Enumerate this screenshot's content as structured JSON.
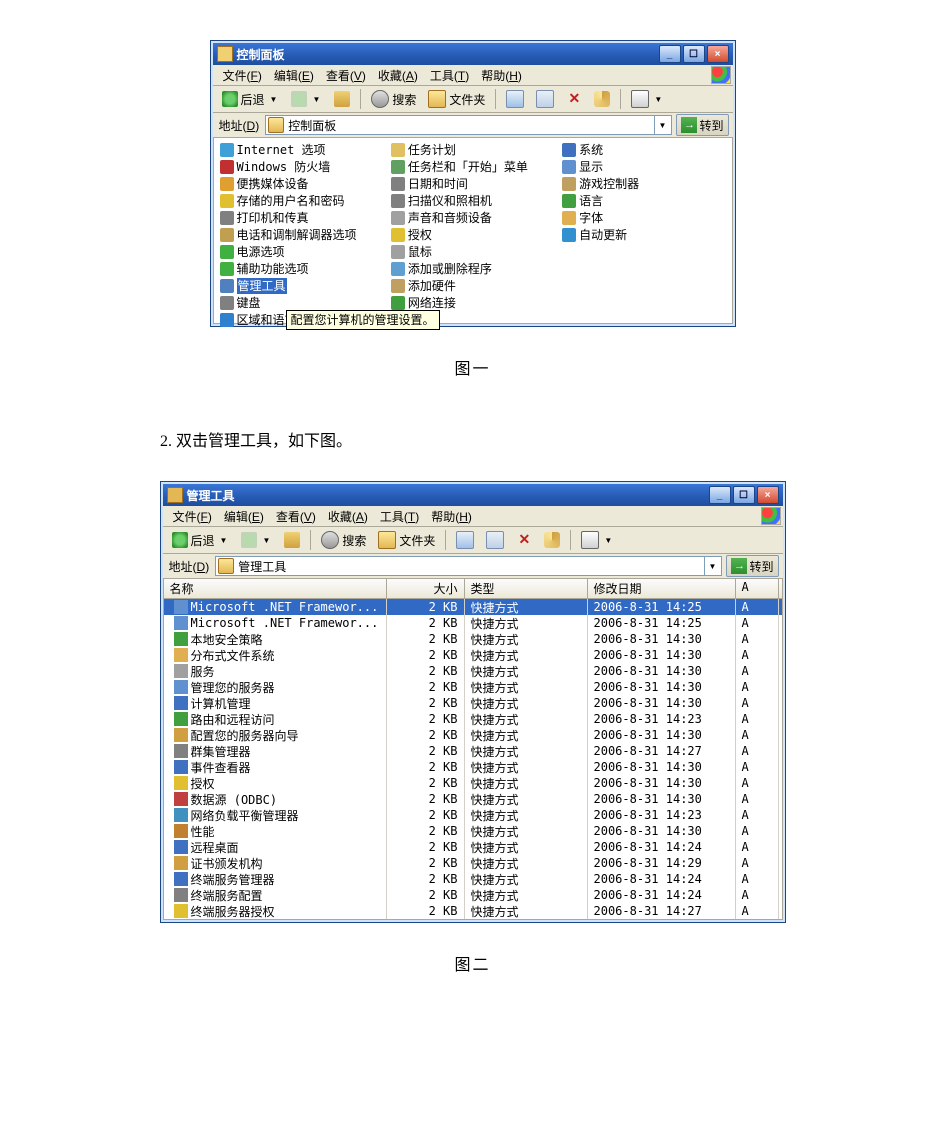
{
  "captions": {
    "fig1": "图一",
    "fig2": "图二"
  },
  "step2_text": "2. 双击管理工具，如下图。",
  "win1": {
    "title": "控制面板",
    "menus": [
      {
        "label": "文件",
        "accel": "F"
      },
      {
        "label": "编辑",
        "accel": "E"
      },
      {
        "label": "查看",
        "accel": "V"
      },
      {
        "label": "收藏",
        "accel": "A"
      },
      {
        "label": "工具",
        "accel": "T"
      },
      {
        "label": "帮助",
        "accel": "H"
      }
    ],
    "toolbar": {
      "back": "后退",
      "search": "搜索",
      "folders": "文件夹"
    },
    "address": {
      "label": "地址",
      "accel": "D",
      "value": "控制面板",
      "go": "转到"
    },
    "selected": "管理工具",
    "tooltip": "配置您计算机的管理设置。",
    "columns": [
      [
        {
          "t": "Internet 选项",
          "c": "#3fa0d8"
        },
        {
          "t": "Windows 防火墙",
          "c": "#c03030"
        },
        {
          "t": "便携媒体设备",
          "c": "#e0a030"
        },
        {
          "t": "存储的用户名和密码",
          "c": "#e0c030"
        },
        {
          "t": "打印机和传真",
          "c": "#808080"
        },
        {
          "t": "电话和调制解调器选项",
          "c": "#c0a050"
        },
        {
          "t": "电源选项",
          "c": "#40b040"
        },
        {
          "t": "辅助功能选项",
          "c": "#40b040"
        },
        {
          "t": "管理工具",
          "c": "#5080c0"
        },
        {
          "t": "键盘",
          "c": "#808080"
        },
        {
          "t": "区域和语言选项",
          "c": "#3080d0"
        }
      ],
      [
        {
          "t": "任务计划",
          "c": "#e0c060"
        },
        {
          "t": "任务栏和「开始」菜单",
          "c": "#60a060"
        },
        {
          "t": "日期和时间",
          "c": "#808080"
        },
        {
          "t": "扫描仪和照相机",
          "c": "#808080"
        },
        {
          "t": "声音和音频设备",
          "c": "#a0a0a0"
        },
        {
          "t": "授权",
          "c": "#e0c030"
        },
        {
          "t": "鼠标",
          "c": "#a0a0a0"
        },
        {
          "t": "添加或删除程序",
          "c": "#60a0d0"
        },
        {
          "t": "添加硬件",
          "c": "#c0a060"
        },
        {
          "t": "网络连接",
          "c": "#40a040"
        }
      ],
      [
        {
          "t": "系统",
          "c": "#4070c0"
        },
        {
          "t": "显示",
          "c": "#6090d0"
        },
        {
          "t": "游戏控制器",
          "c": "#c0a060"
        },
        {
          "t": "语言",
          "c": "#40a040"
        },
        {
          "t": "字体",
          "c": "#e0b050"
        },
        {
          "t": "自动更新",
          "c": "#3090d0"
        }
      ]
    ]
  },
  "win2": {
    "title": "管理工具",
    "menus": [
      {
        "label": "文件",
        "accel": "F"
      },
      {
        "label": "编辑",
        "accel": "E"
      },
      {
        "label": "查看",
        "accel": "V"
      },
      {
        "label": "收藏",
        "accel": "A"
      },
      {
        "label": "工具",
        "accel": "T"
      },
      {
        "label": "帮助",
        "accel": "H"
      }
    ],
    "toolbar": {
      "back": "后退",
      "search": "搜索",
      "folders": "文件夹"
    },
    "address": {
      "label": "地址",
      "accel": "D",
      "value": "管理工具",
      "go": "转到"
    },
    "columns": {
      "name": "名称",
      "size": "大小",
      "type": "类型",
      "date": "修改日期",
      "attr": "A"
    },
    "rows": [
      {
        "name": "Microsoft .NET Framewor...",
        "sel": true,
        "size": "2 KB",
        "type": "快捷方式",
        "date": "2006-8-31 14:25",
        "attr": "A",
        "c": "#6090d0"
      },
      {
        "name": "Microsoft .NET Framewor...",
        "sel": false,
        "size": "2 KB",
        "type": "快捷方式",
        "date": "2006-8-31 14:25",
        "attr": "A",
        "c": "#6090d0"
      },
      {
        "name": "本地安全策略",
        "sel": false,
        "size": "2 KB",
        "type": "快捷方式",
        "date": "2006-8-31 14:30",
        "attr": "A",
        "c": "#40a040"
      },
      {
        "name": "分布式文件系统",
        "sel": false,
        "size": "2 KB",
        "type": "快捷方式",
        "date": "2006-8-31 14:30",
        "attr": "A",
        "c": "#e0b050"
      },
      {
        "name": "服务",
        "sel": false,
        "size": "2 KB",
        "type": "快捷方式",
        "date": "2006-8-31 14:30",
        "attr": "A",
        "c": "#a0a0a0"
      },
      {
        "name": "管理您的服务器",
        "sel": false,
        "size": "2 KB",
        "type": "快捷方式",
        "date": "2006-8-31 14:30",
        "attr": "A",
        "c": "#6090d0"
      },
      {
        "name": "计算机管理",
        "sel": false,
        "size": "2 KB",
        "type": "快捷方式",
        "date": "2006-8-31 14:30",
        "attr": "A",
        "c": "#4070c0"
      },
      {
        "name": "路由和远程访问",
        "sel": false,
        "size": "2 KB",
        "type": "快捷方式",
        "date": "2006-8-31 14:23",
        "attr": "A",
        "c": "#40a040"
      },
      {
        "name": "配置您的服务器向导",
        "sel": false,
        "size": "2 KB",
        "type": "快捷方式",
        "date": "2006-8-31 14:30",
        "attr": "A",
        "c": "#d0a040"
      },
      {
        "name": "群集管理器",
        "sel": false,
        "size": "2 KB",
        "type": "快捷方式",
        "date": "2006-8-31 14:27",
        "attr": "A",
        "c": "#808080"
      },
      {
        "name": "事件查看器",
        "sel": false,
        "size": "2 KB",
        "type": "快捷方式",
        "date": "2006-8-31 14:30",
        "attr": "A",
        "c": "#4070c0"
      },
      {
        "name": "授权",
        "sel": false,
        "size": "2 KB",
        "type": "快捷方式",
        "date": "2006-8-31 14:30",
        "attr": "A",
        "c": "#e0c030"
      },
      {
        "name": "数据源 (ODBC)",
        "sel": false,
        "size": "2 KB",
        "type": "快捷方式",
        "date": "2006-8-31 14:30",
        "attr": "A",
        "c": "#c04040"
      },
      {
        "name": "网络负载平衡管理器",
        "sel": false,
        "size": "2 KB",
        "type": "快捷方式",
        "date": "2006-8-31 14:23",
        "attr": "A",
        "c": "#4090c0"
      },
      {
        "name": "性能",
        "sel": false,
        "size": "2 KB",
        "type": "快捷方式",
        "date": "2006-8-31 14:30",
        "attr": "A",
        "c": "#c08030"
      },
      {
        "name": "远程桌面",
        "sel": false,
        "size": "2 KB",
        "type": "快捷方式",
        "date": "2006-8-31 14:24",
        "attr": "A",
        "c": "#4070c0"
      },
      {
        "name": "证书颁发机构",
        "sel": false,
        "size": "2 KB",
        "type": "快捷方式",
        "date": "2006-8-31 14:29",
        "attr": "A",
        "c": "#d0a040"
      },
      {
        "name": "终端服务管理器",
        "sel": false,
        "size": "2 KB",
        "type": "快捷方式",
        "date": "2006-8-31 14:24",
        "attr": "A",
        "c": "#4070c0"
      },
      {
        "name": "终端服务配置",
        "sel": false,
        "size": "2 KB",
        "type": "快捷方式",
        "date": "2006-8-31 14:24",
        "attr": "A",
        "c": "#808080"
      },
      {
        "name": "终端服务器授权",
        "sel": false,
        "size": "2 KB",
        "type": "快捷方式",
        "date": "2006-8-31 14:27",
        "attr": "A",
        "c": "#e0c030"
      }
    ]
  }
}
